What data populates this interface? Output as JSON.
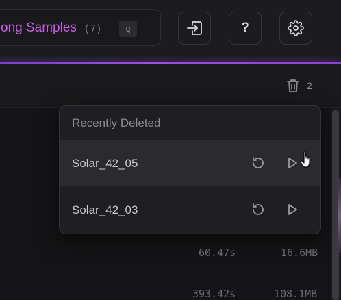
{
  "header": {
    "sample_title": "ong Samples",
    "sample_count": "(7)",
    "shortcut_key": "q",
    "buttons": [
      {
        "icon": "import-icon"
      },
      {
        "icon": "help-icon",
        "glyph": "?"
      },
      {
        "icon": "gear-icon"
      }
    ]
  },
  "toolbar": {
    "trash_count": "2"
  },
  "recently_deleted": {
    "header": "Recently Deleted",
    "items": [
      {
        "label": "Solar_42_05",
        "hovered": true
      },
      {
        "label": "Solar_42_03",
        "hovered": false
      }
    ]
  },
  "table": {
    "rows": [
      {
        "duration": "60.47s",
        "size": "16.6MB"
      },
      {
        "duration": "393.42s",
        "size": "108.1MB"
      }
    ]
  },
  "colors": {
    "accent": "#9b4fe6",
    "title": "#c85ee6",
    "background": "#17171a"
  }
}
